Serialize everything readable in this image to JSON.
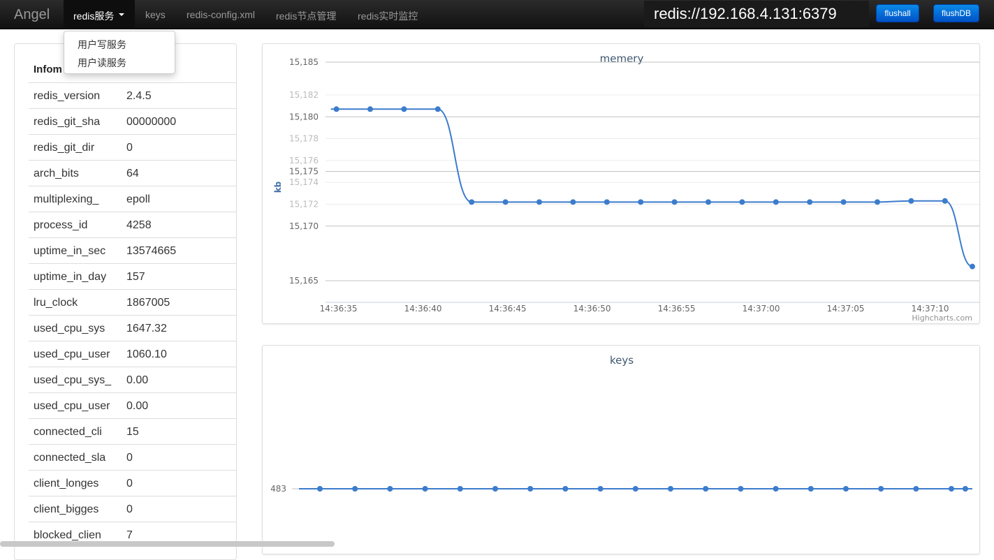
{
  "navbar": {
    "brand": "Angel",
    "active_menu": "redis服务",
    "items": [
      "keys",
      "redis-config.xml",
      "redis节点管理",
      "redis实时监控"
    ],
    "connection": "redis://192.168.4.131:6379",
    "flushall_label": "flushall",
    "flushdb_label": "flushDB"
  },
  "dropdown": {
    "items": [
      "用户写服务",
      "用户读服务"
    ]
  },
  "info": {
    "title": "Infom",
    "rows": [
      {
        "key": "redis_version",
        "value": "2.4.5"
      },
      {
        "key": "redis_git_sha",
        "value": "00000000"
      },
      {
        "key": "redis_git_dir",
        "value": "0"
      },
      {
        "key": "arch_bits",
        "value": "64"
      },
      {
        "key": "multiplexing_",
        "value": "epoll"
      },
      {
        "key": "process_id",
        "value": "4258"
      },
      {
        "key": "uptime_in_sec",
        "value": "13574665"
      },
      {
        "key": "uptime_in_day",
        "value": "157"
      },
      {
        "key": "lru_clock",
        "value": "1867005"
      },
      {
        "key": "used_cpu_sys",
        "value": "1647.32"
      },
      {
        "key": "used_cpu_user",
        "value": "1060.10"
      },
      {
        "key": "used_cpu_sys_",
        "value": "0.00"
      },
      {
        "key": "used_cpu_user",
        "value": "0.00"
      },
      {
        "key": "connected_cli",
        "value": "15"
      },
      {
        "key": "connected_sla",
        "value": "0"
      },
      {
        "key": "client_longes",
        "value": "0"
      },
      {
        "key": "client_bigges",
        "value": "0"
      },
      {
        "key": "blocked_clien",
        "value": "7"
      }
    ]
  },
  "chart_data": [
    {
      "type": "line",
      "title": "memery",
      "ylabel": "kb",
      "credits": "Highcharts.com",
      "line_color": "#3b7ccc",
      "yticks": [
        15185,
        15182,
        15180,
        15178,
        15176,
        15175,
        15174,
        15172,
        15170,
        15165
      ],
      "ytick_labels": [
        "15,185",
        "15,182",
        "15,180",
        "15,178",
        "15,176",
        "15,175",
        "15,174",
        "15,172",
        "15,170",
        "15,165"
      ],
      "xticks": [
        "14:36:35",
        "14:36:40",
        "14:36:45",
        "14:36:50",
        "14:36:55",
        "14:37:00",
        "14:37:05",
        "14:37:10"
      ],
      "x": [
        "14:36:35",
        "14:36:37",
        "14:36:39",
        "14:36:41",
        "14:36:43",
        "14:36:45",
        "14:36:47",
        "14:36:49",
        "14:36:51",
        "14:36:53",
        "14:36:55",
        "14:36:57",
        "14:36:59",
        "14:37:01",
        "14:37:03",
        "14:37:05",
        "14:37:07",
        "14:37:09",
        "14:37:11",
        "14:37:13"
      ],
      "values": [
        15180.7,
        15180.7,
        15180.7,
        15180.7,
        15172.2,
        15172.2,
        15172.2,
        15172.2,
        15172.2,
        15172.2,
        15172.2,
        15172.2,
        15172.2,
        15172.2,
        15172.2,
        15172.2,
        15172.2,
        15172.3,
        15172.3,
        15166.3
      ]
    },
    {
      "type": "line",
      "title": "keys",
      "ytick_labels": [
        "483"
      ],
      "line_color": "#3b7ccc",
      "values": [
        483,
        483,
        483,
        483,
        483,
        483,
        483,
        483,
        483,
        483,
        483,
        483,
        483,
        483,
        483,
        483,
        483,
        483,
        483,
        483
      ]
    }
  ]
}
